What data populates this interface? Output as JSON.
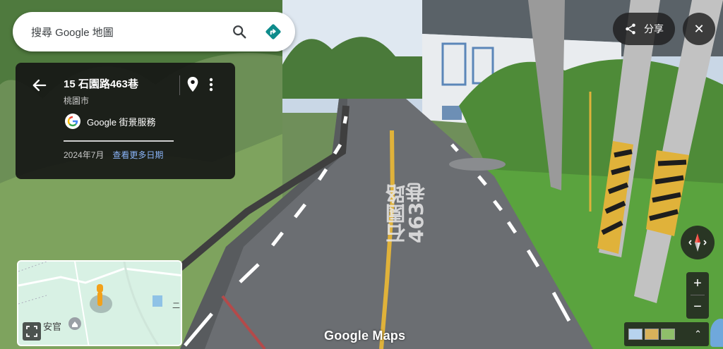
{
  "search": {
    "placeholder": "搜尋 Google 地圖"
  },
  "info_card": {
    "title": "15 石園路463巷",
    "subtitle": "桃園市",
    "provider": "Google 街景服務",
    "date": "2024年7月",
    "more_dates_link": "查看更多日期"
  },
  "top_right": {
    "share_label": "分享",
    "close_label": "✕"
  },
  "zoom": {
    "in_label": "+",
    "out_label": "−"
  },
  "minimap": {
    "place_label": "安官",
    "edge_label": "二"
  },
  "watermark": "Google Maps",
  "road_marking": "石園路463巷",
  "layers": {
    "chevron": "⌃"
  },
  "colors": {
    "accent_blue": "#1a73e8",
    "link_blue": "#8ab4f8",
    "directions_teal": "#0f8c8c"
  }
}
